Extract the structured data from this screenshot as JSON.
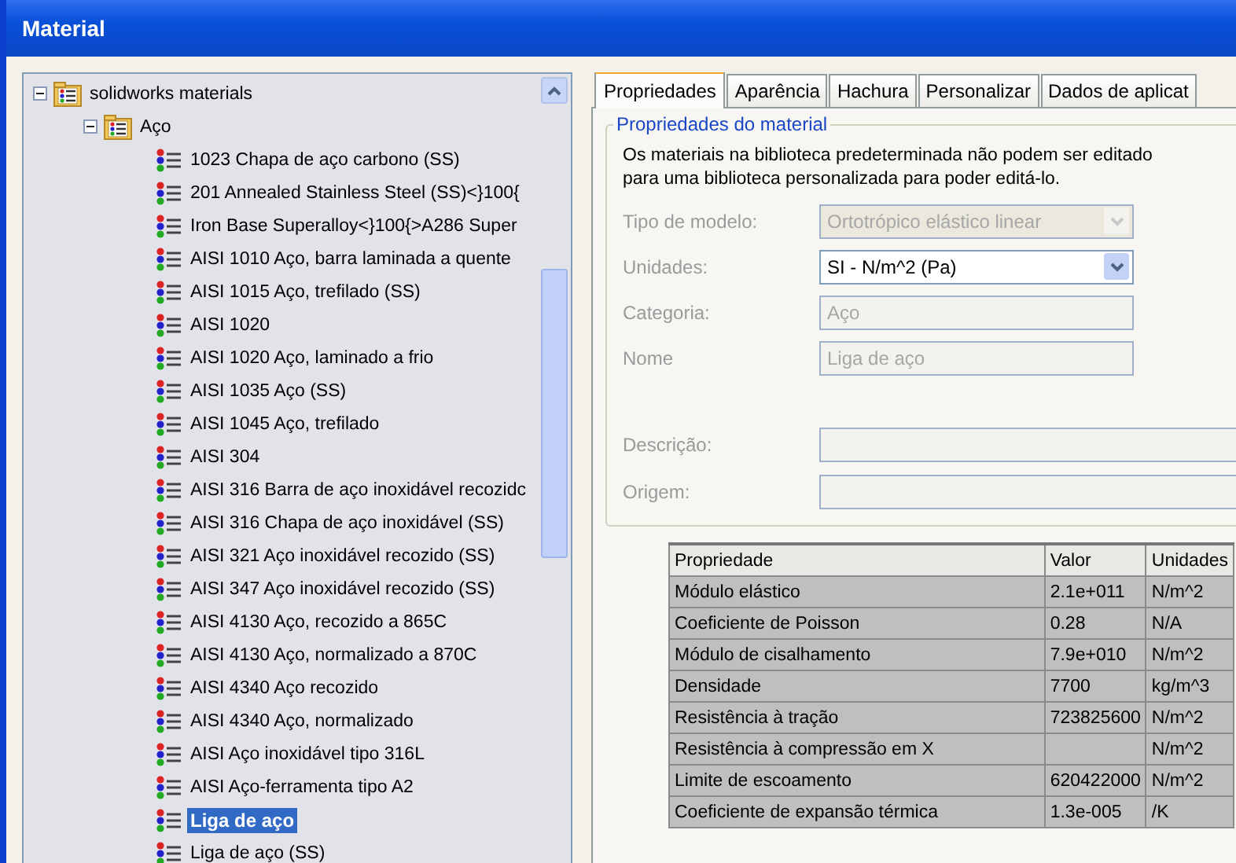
{
  "window": {
    "title": "Material"
  },
  "tree": [
    {
      "label": "solidworks materials",
      "kind": "folder",
      "expanded": true,
      "selected": false,
      "children": [
        {
          "label": "Aço",
          "kind": "folder",
          "expanded": true,
          "selected": false,
          "children": [
            {
              "label": "1023 Chapa de aço carbono (SS)",
              "kind": "material",
              "selected": false
            },
            {
              "label": "201 Annealed Stainless Steel (SS)<}100{",
              "kind": "material",
              "selected": false
            },
            {
              "label": "Iron Base Superalloy<}100{>A286 Super",
              "kind": "material",
              "selected": false
            },
            {
              "label": "AISI 1010 Aço, barra laminada a quente",
              "kind": "material",
              "selected": false
            },
            {
              "label": "AISI 1015 Aço, trefilado (SS)",
              "kind": "material",
              "selected": false
            },
            {
              "label": "AISI 1020",
              "kind": "material",
              "selected": false
            },
            {
              "label": "AISI 1020 Aço, laminado a frio",
              "kind": "material",
              "selected": false
            },
            {
              "label": "AISI 1035 Aço (SS)",
              "kind": "material",
              "selected": false
            },
            {
              "label": "AISI 1045 Aço, trefilado",
              "kind": "material",
              "selected": false
            },
            {
              "label": "AISI 304",
              "kind": "material",
              "selected": false
            },
            {
              "label": "AISI 316 Barra de aço inoxidável recozidc",
              "kind": "material",
              "selected": false
            },
            {
              "label": "AISI 316 Chapa de aço inoxidável (SS)",
              "kind": "material",
              "selected": false
            },
            {
              "label": "AISI 321 Aço inoxidável recozido (SS)",
              "kind": "material",
              "selected": false
            },
            {
              "label": "AISI 347 Aço inoxidável recozido (SS)",
              "kind": "material",
              "selected": false
            },
            {
              "label": "AISI 4130 Aço, recozido a 865C",
              "kind": "material",
              "selected": false
            },
            {
              "label": "AISI 4130 Aço, normalizado a 870C",
              "kind": "material",
              "selected": false
            },
            {
              "label": "AISI 4340 Aço recozido",
              "kind": "material",
              "selected": false
            },
            {
              "label": "AISI 4340 Aço, normalizado",
              "kind": "material",
              "selected": false
            },
            {
              "label": "AISI Aço inoxidável tipo 316L",
              "kind": "material",
              "selected": false
            },
            {
              "label": "AISI Aço-ferramenta tipo A2",
              "kind": "material",
              "selected": false
            },
            {
              "label": "Liga de aço",
              "kind": "material",
              "selected": true
            },
            {
              "label": "Liga de aço (SS)",
              "kind": "material",
              "selected": false
            }
          ]
        }
      ]
    }
  ],
  "tabs": [
    {
      "label": "Propriedades",
      "selected": true
    },
    {
      "label": "Aparência",
      "selected": false
    },
    {
      "label": "Hachura",
      "selected": false
    },
    {
      "label": "Personalizar",
      "selected": false
    },
    {
      "label": "Dados de aplicat",
      "selected": false
    }
  ],
  "group": {
    "title": "Propriedades do material",
    "note_lines": [
      "Os materiais na biblioteca predeterminada não podem ser editado",
      "para uma biblioteca personalizada para poder editá-lo."
    ],
    "fields": [
      {
        "label": "Tipo de modelo:",
        "kind": "dropdown",
        "value": "Ortotrópico elástico linear",
        "disabled": true
      },
      {
        "label": "Unidades:",
        "kind": "dropdown",
        "value": "SI - N/m^2 (Pa)",
        "disabled": false
      },
      {
        "label": "Categoria:",
        "kind": "text",
        "value": "Aço",
        "disabled": true
      },
      {
        "label": "Nome",
        "kind": "text",
        "value": "Liga de aço",
        "disabled": true
      },
      {
        "label": "Descrição:",
        "kind": "wide",
        "disabled": true
      },
      {
        "label": "Origem:",
        "kind": "wide",
        "disabled": true
      }
    ]
  },
  "table": {
    "columns": [
      "Propriedade",
      "Valor",
      "Unidades"
    ],
    "rows": [
      [
        "Módulo elástico",
        "2.1e+011",
        "N/m^2"
      ],
      [
        "Coeficiente de Poisson",
        "0.28",
        "N/A"
      ],
      [
        "Módulo de cisalhamento",
        "7.9e+010",
        "N/m^2"
      ],
      [
        "Densidade",
        "7700",
        "kg/m^3"
      ],
      [
        "Resistência à tração",
        "723825600",
        "N/m^2"
      ],
      [
        "Resistência à compressão em X",
        "",
        "N/m^2"
      ],
      [
        "Limite de escoamento",
        "620422000",
        "N/m^2"
      ],
      [
        "Coeficiente de expansão térmica",
        "1.3e-005",
        "/K"
      ]
    ]
  }
}
